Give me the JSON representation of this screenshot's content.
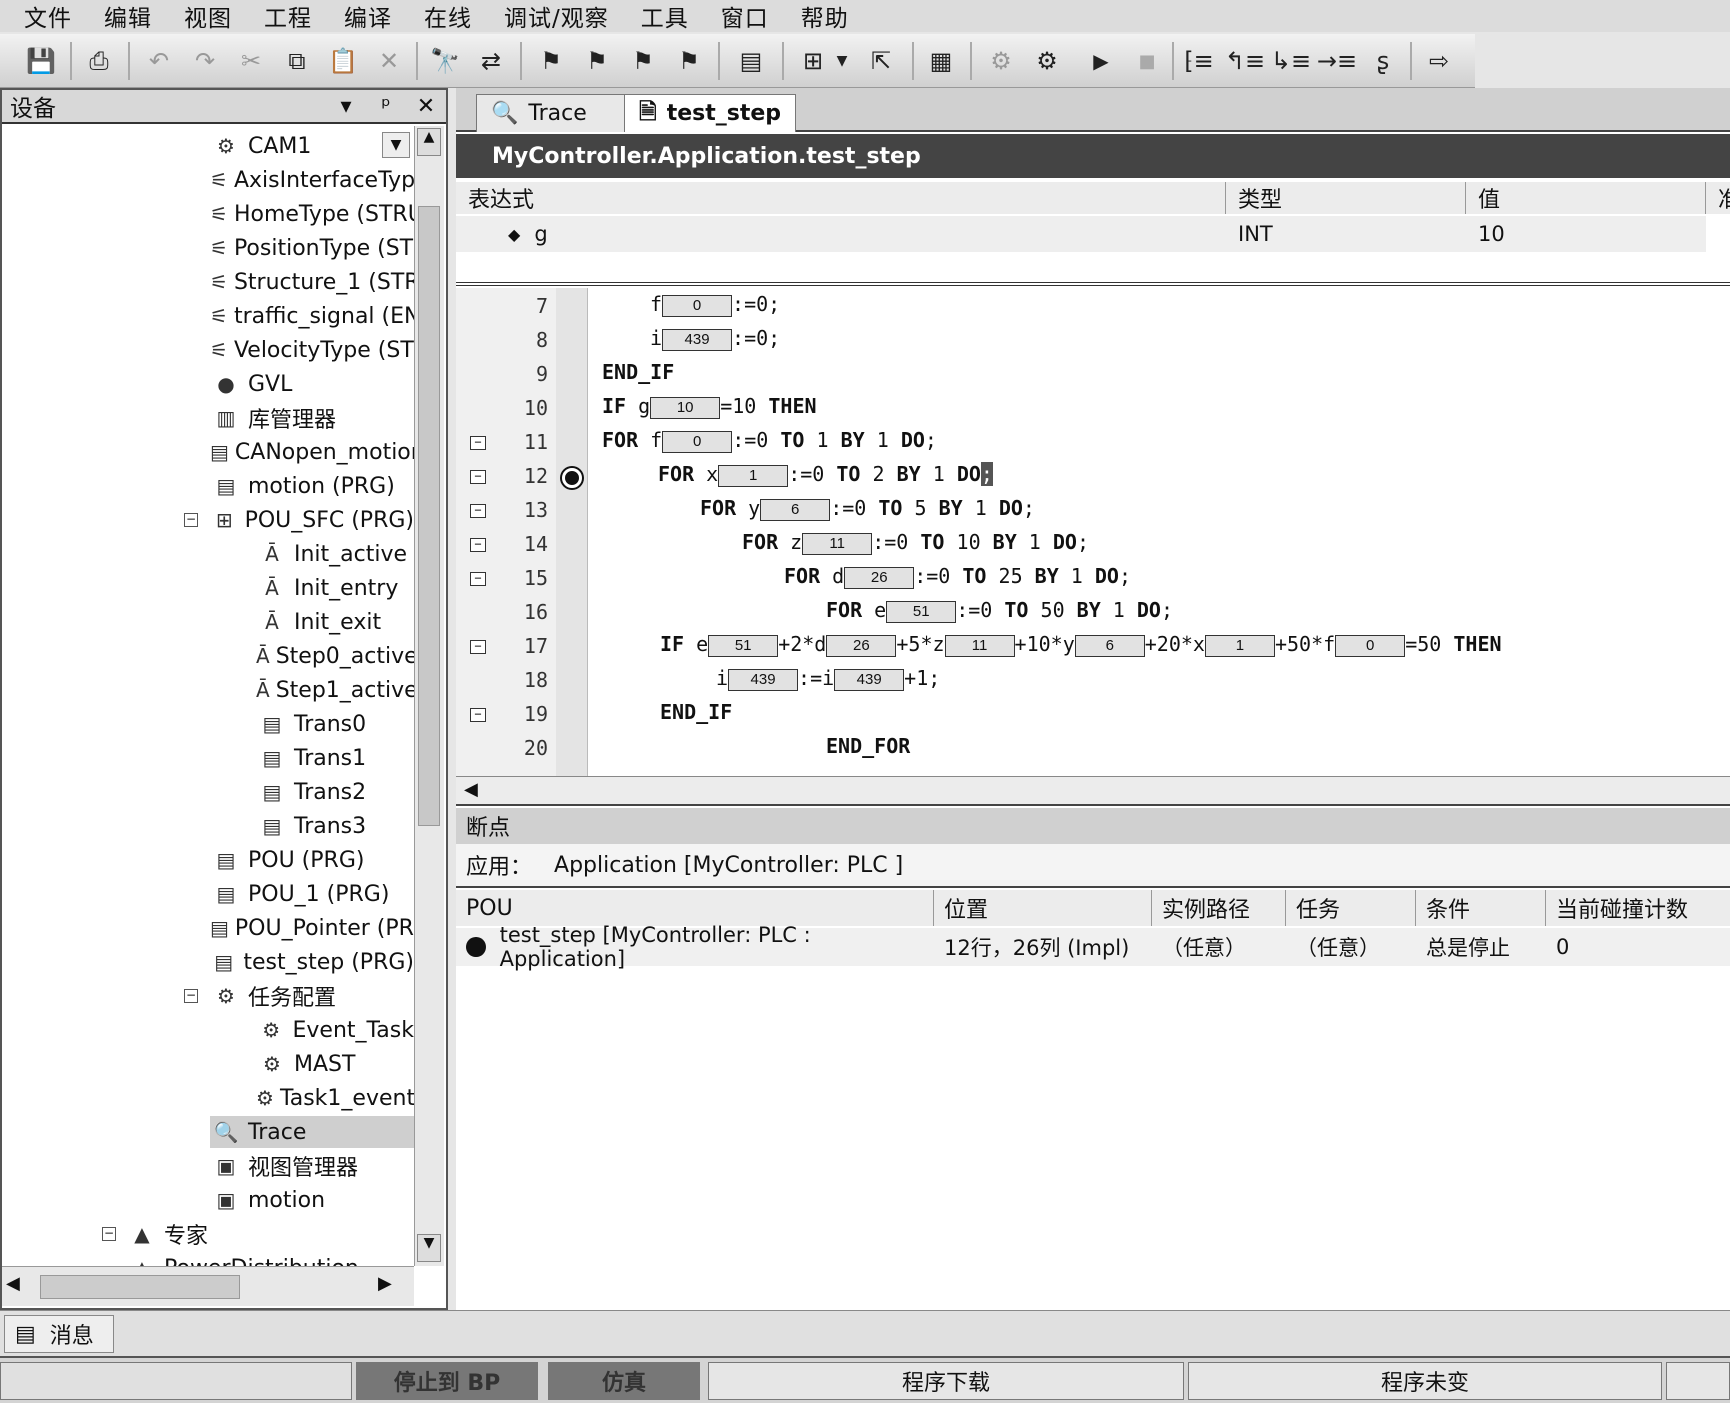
{
  "menu": [
    "文件",
    "编辑",
    "视图",
    "工程",
    "编译",
    "在线",
    "调试/观察",
    "工具",
    "窗口",
    "帮助"
  ],
  "toolbar": {
    "icons": [
      "save-icon",
      "print-icon",
      "undo-icon",
      "redo-icon",
      "cut-icon",
      "copy-icon",
      "paste-icon",
      "delete-icon",
      "find-icon",
      "replace-icon",
      "bookmark-icon",
      "bookmark-next-icon",
      "bookmark-prev-icon",
      "bookmark-clear-icon",
      "build-icon",
      "device-icon",
      "dropdown-icon",
      "export-icon",
      "login-icon",
      "logout-icon",
      "download-icon",
      "start-icon",
      "stop-icon",
      "breakpoint-icon",
      "step-over-icon",
      "step-into-icon",
      "step-out-icon",
      "run-to-cursor-icon",
      "forward-icon"
    ]
  },
  "devices": {
    "title": "设备",
    "pin": "ᵖ",
    "close": "✕",
    "items": [
      {
        "label": "CAM1",
        "icon": "cam-icon",
        "indent": 1
      },
      {
        "label": "AxisInterfaceTyp",
        "icon": "struct-icon",
        "indent": 1
      },
      {
        "label": "HomeType (STRU",
        "icon": "struct-icon",
        "indent": 1
      },
      {
        "label": "PositionType (STF",
        "icon": "struct-icon",
        "indent": 1
      },
      {
        "label": "Structure_1 (STR",
        "icon": "struct-icon",
        "indent": 1
      },
      {
        "label": "traffic_signal (ENI",
        "icon": "struct-icon",
        "indent": 1
      },
      {
        "label": "VelocityType (STF",
        "icon": "struct-icon",
        "indent": 1
      },
      {
        "label": "GVL",
        "icon": "globe-icon",
        "indent": 1
      },
      {
        "label": "库管理器",
        "icon": "library-icon",
        "indent": 1
      },
      {
        "label": "CANopen_motion",
        "icon": "pou-icon",
        "indent": 1
      },
      {
        "label": "motion (PRG)",
        "icon": "pou-icon",
        "indent": 1
      },
      {
        "label": "POU_SFC (PRG)",
        "icon": "sfc-icon",
        "indent": 1
      },
      {
        "label": "Init_active",
        "icon": "action-icon",
        "indent": 2
      },
      {
        "label": "Init_entry",
        "icon": "action-icon",
        "indent": 2
      },
      {
        "label": "Init_exit",
        "icon": "action-icon",
        "indent": 2
      },
      {
        "label": "Step0_active",
        "icon": "action-icon",
        "indent": 2
      },
      {
        "label": "Step1_active",
        "icon": "action-icon",
        "indent": 2
      },
      {
        "label": "Trans0",
        "icon": "transition-icon",
        "indent": 2
      },
      {
        "label": "Trans1",
        "icon": "transition-icon",
        "indent": 2
      },
      {
        "label": "Trans2",
        "icon": "transition-icon",
        "indent": 2
      },
      {
        "label": "Trans3",
        "icon": "transition-icon",
        "indent": 2
      },
      {
        "label": "POU (PRG)",
        "icon": "pou-icon",
        "indent": 1
      },
      {
        "label": "POU_1 (PRG)",
        "icon": "pou-icon",
        "indent": 1
      },
      {
        "label": "POU_Pointer (PR(",
        "icon": "pou-icon",
        "indent": 1
      },
      {
        "label": "test_step (PRG)",
        "icon": "pou-icon",
        "indent": 1
      },
      {
        "label": "任务配置",
        "icon": "task-config-icon",
        "indent": 1
      },
      {
        "label": "Event_Task",
        "icon": "task-icon",
        "indent": 2
      },
      {
        "label": "MAST",
        "icon": "task-icon",
        "indent": 2
      },
      {
        "label": "Task1_event",
        "icon": "task-icon",
        "indent": 2
      },
      {
        "label": "Trace",
        "icon": "trace-icon",
        "indent": 1,
        "selected": true
      },
      {
        "label": "视图管理器",
        "icon": "view-manager-icon",
        "indent": 1
      },
      {
        "label": "motion",
        "icon": "motion-icon",
        "indent": 1
      },
      {
        "label": "专家",
        "icon": "expert-icon",
        "indent": 0
      },
      {
        "label": "PowerDistribution",
        "icon": "power-icon",
        "indent": 0
      }
    ]
  },
  "editor": {
    "tabs": [
      {
        "label": "Trace",
        "icon": "trace-icon"
      },
      {
        "label": "test_step",
        "icon": "document-icon"
      }
    ],
    "path": "MyController.Application.test_step",
    "watch": {
      "headers": [
        "表达式",
        "类型",
        "值",
        "准"
      ],
      "rows": [
        {
          "expr": "g",
          "type": "INT",
          "value": "10"
        }
      ]
    },
    "lines": [
      7,
      8,
      9,
      10,
      11,
      12,
      13,
      14,
      15,
      16,
      17,
      18,
      19,
      20
    ],
    "values": {
      "f": "0",
      "i": "439",
      "g": "10",
      "x": "1",
      "y": "6",
      "z": "11",
      "d": "26",
      "e": "51"
    }
  },
  "breakpoints": {
    "title": "断点",
    "app_label": "应用：",
    "app_value": "Application [MyController: PLC ]",
    "headers": [
      "POU",
      "位置",
      "实例路径",
      "任务",
      "条件",
      "当前碰撞计数"
    ],
    "rows": [
      {
        "pou": "test_step [MyController: PLC : Application]",
        "pos": "12行，26列 (Impl)",
        "inst": "（任意）",
        "task": "（任意）",
        "cond": "总是停止",
        "count": "0"
      }
    ]
  },
  "messages": {
    "label": "消息"
  },
  "status": {
    "stop_bp": "停止到 BP",
    "sim": "仿真",
    "download": "程序下载",
    "unchanged": "程序未变"
  }
}
